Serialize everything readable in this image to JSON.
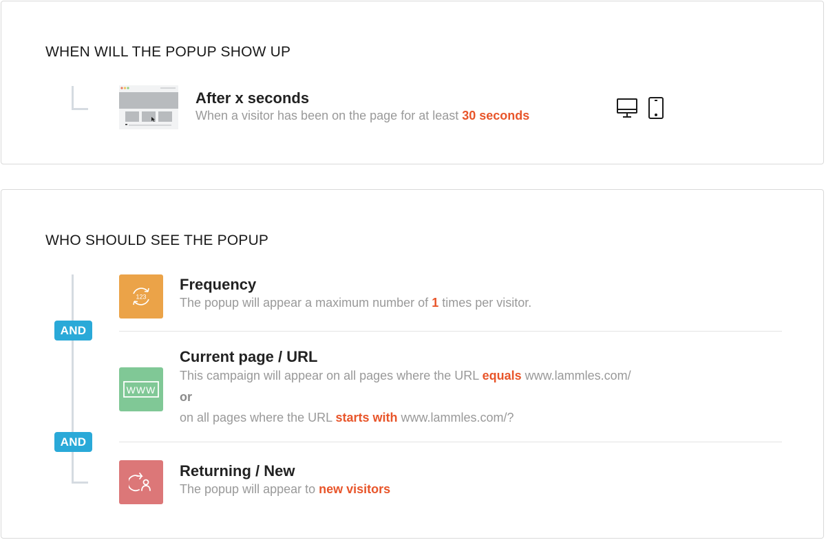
{
  "trigger_section": {
    "title": "WHEN WILL THE POPUP SHOW UP",
    "item": {
      "title": "After x seconds",
      "desc_prefix": "When a visitor has been on the page for at least ",
      "desc_highlight": "30 seconds",
      "thumb_icon": "browser-page-thumbnail-icon"
    },
    "devices": [
      "desktop-icon",
      "mobile-icon"
    ]
  },
  "audience_section": {
    "title": "WHO SHOULD SEE THE POPUP",
    "connector_label": "AND",
    "frequency": {
      "title": "Frequency",
      "icon_text": "123",
      "icon_color": "#eba348",
      "desc_prefix": "The popup will appear a maximum number of ",
      "desc_highlight": "1",
      "desc_suffix": " times per visitor."
    },
    "url": {
      "title": "Current page / URL",
      "icon_text": "WWW",
      "icon_color": "#80c896",
      "line1_prefix": "This campaign will appear on all pages where the URL ",
      "line1_highlight": "equals",
      "line1_suffix": " www.lammles.com/",
      "or_label": "or",
      "line2_prefix": "on all pages where the URL ",
      "line2_highlight": "starts with",
      "line2_suffix": " www.lammles.com/?"
    },
    "returning": {
      "title": "Returning / New",
      "icon_color": "#dc7778",
      "desc_prefix": "The popup will appear to ",
      "desc_highlight": "new visitors"
    }
  },
  "colors": {
    "accent_highlight": "#e8552a",
    "connector_badge": "#2aa9d8"
  }
}
